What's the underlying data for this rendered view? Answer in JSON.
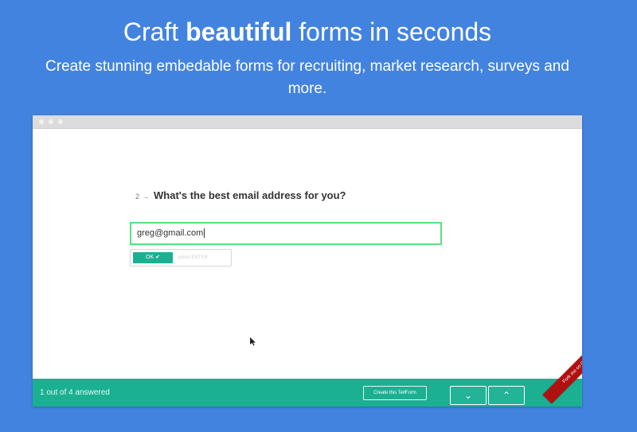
{
  "hero": {
    "title_pre": "Craft ",
    "title_bold": "beautiful",
    "title_post": " forms in seconds",
    "subtitle": "Create stunning embedable forms for recruiting, market research, surveys and more."
  },
  "form": {
    "question_number": "2",
    "question_arrow": "→",
    "question_text": "What's the best email address for you?",
    "email_value": "greg@gmail.com",
    "ok_label": "OK ✔",
    "press_enter": "press ENTER"
  },
  "footer": {
    "progress_text": "1 out of 4 answered",
    "create_label": "Create this TellForm",
    "down_icon": "chevron-down-icon",
    "up_icon": "chevron-up-icon",
    "down_glyph": "⌄",
    "up_glyph": "⌃",
    "ribbon_text": "Fork me on GitHub"
  },
  "colors": {
    "background": "#4383e0",
    "accent": "#1bb092",
    "input_border": "#58e07f",
    "ribbon": "#b11010"
  }
}
